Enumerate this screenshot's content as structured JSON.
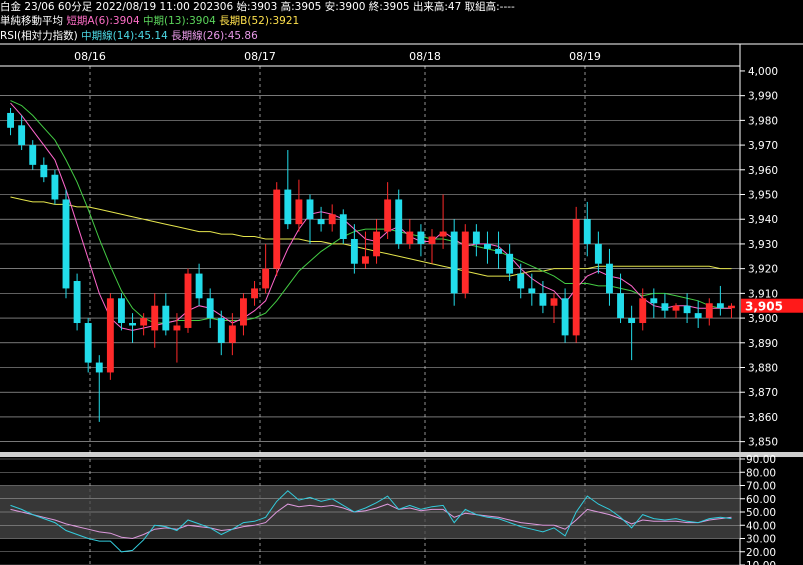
{
  "header": {
    "row1": "白金 23/06 60分足 2022/08/19 11:00 202306 始:3903 高:3905 安:3900 終:3905 出来高:47 取組高:----",
    "row2": {
      "title": "単純移動平均",
      "ma_short": "短期A(6):3904",
      "ma_mid": "中期(13):3904",
      "ma_long": "長期B(52):3921"
    },
    "row3": {
      "title": "RSI(相対力指数)",
      "rsi_mid": "中期線(14):45.14",
      "rsi_long": "長期線(26):45.86"
    }
  },
  "colors": {
    "up": "#ff2a2a",
    "down": "#22dcea",
    "ma_short": "#ff66cc",
    "ma_mid": "#44cc44",
    "ma_long": "#e6e64d",
    "rsi_mid": "#33ccdd",
    "rsi_long": "#dd99dd",
    "price_tag": "#ff1a1a",
    "grid": "#ffffff"
  },
  "chart_data": [
    {
      "type": "candlestick",
      "x_tick_labels": [
        "08/16",
        "08/17",
        "08/18",
        "08/19"
      ],
      "y_tick_labels": [
        "4,000",
        "3,990",
        "3,980",
        "3,970",
        "3,960",
        "3,950",
        "3,940",
        "3,930",
        "3,920",
        "3,910",
        "3,900",
        "3,890",
        "3,880",
        "3,870",
        "3,860",
        "3,850"
      ],
      "ylim": [
        3845,
        4002
      ],
      "last_price_label": "3,905",
      "last_price": 3905,
      "day_starts": [
        6,
        21,
        36
      ],
      "day_label_at": [
        4,
        19,
        34,
        49
      ],
      "ohlc": [
        [
          3983,
          3985,
          3974,
          3977
        ],
        [
          3978,
          3982,
          3968,
          3970
        ],
        [
          3970,
          3972,
          3960,
          3962
        ],
        [
          3962,
          3965,
          3955,
          3957
        ],
        [
          3958,
          3960,
          3946,
          3948
        ],
        [
          3948,
          3952,
          3908,
          3912
        ],
        [
          3915,
          3918,
          3895,
          3898
        ],
        [
          3898,
          3900,
          3878,
          3882
        ],
        [
          3882,
          3885,
          3858,
          3878
        ],
        [
          3878,
          3910,
          3875,
          3908
        ],
        [
          3908,
          3910,
          3895,
          3898
        ],
        [
          3898,
          3902,
          3890,
          3897
        ],
        [
          3897,
          3902,
          3893,
          3900
        ],
        [
          3895,
          3910,
          3888,
          3905
        ],
        [
          3905,
          3910,
          3893,
          3895
        ],
        [
          3895,
          3902,
          3882,
          3897
        ],
        [
          3896,
          3920,
          3894,
          3918
        ],
        [
          3918,
          3922,
          3905,
          3908
        ],
        [
          3908,
          3912,
          3896,
          3900
        ],
        [
          3900,
          3903,
          3885,
          3890
        ],
        [
          3890,
          3902,
          3885,
          3897
        ],
        [
          3897,
          3910,
          3893,
          3908
        ],
        [
          3908,
          3915,
          3905,
          3912
        ],
        [
          3912,
          3930,
          3910,
          3920
        ],
        [
          3920,
          3955,
          3917,
          3952
        ],
        [
          3952,
          3968,
          3936,
          3938
        ],
        [
          3938,
          3956,
          3935,
          3948
        ],
        [
          3948,
          3950,
          3930,
          3940
        ],
        [
          3940,
          3945,
          3935,
          3938
        ],
        [
          3938,
          3946,
          3935,
          3942
        ],
        [
          3942,
          3944,
          3930,
          3932
        ],
        [
          3932,
          3938,
          3918,
          3922
        ],
        [
          3922,
          3935,
          3920,
          3925
        ],
        [
          3925,
          3940,
          3922,
          3935
        ],
        [
          3935,
          3955,
          3932,
          3948
        ],
        [
          3948,
          3952,
          3928,
          3930
        ],
        [
          3930,
          3940,
          3928,
          3935
        ],
        [
          3935,
          3938,
          3925,
          3930
        ],
        [
          3930,
          3936,
          3922,
          3933
        ],
        [
          3933,
          3950,
          3928,
          3935
        ],
        [
          3935,
          3940,
          3905,
          3910
        ],
        [
          3910,
          3938,
          3908,
          3935
        ],
        [
          3935,
          3938,
          3925,
          3930
        ],
        [
          3930,
          3935,
          3922,
          3928
        ],
        [
          3928,
          3935,
          3920,
          3926
        ],
        [
          3926,
          3930,
          3915,
          3918
        ],
        [
          3918,
          3922,
          3908,
          3912
        ],
        [
          3912,
          3918,
          3905,
          3910
        ],
        [
          3910,
          3915,
          3902,
          3905
        ],
        [
          3905,
          3910,
          3898,
          3908
        ],
        [
          3908,
          3912,
          3890,
          3893
        ],
        [
          3893,
          3945,
          3890,
          3940
        ],
        [
          3940,
          3947,
          3925,
          3930
        ],
        [
          3930,
          3935,
          3918,
          3922
        ],
        [
          3922,
          3928,
          3905,
          3910
        ],
        [
          3910,
          3918,
          3898,
          3900
        ],
        [
          3900,
          3905,
          3883,
          3898
        ],
        [
          3898,
          3912,
          3895,
          3908
        ],
        [
          3908,
          3912,
          3900,
          3906
        ],
        [
          3906,
          3910,
          3900,
          3903
        ],
        [
          3903,
          3906,
          3900,
          3905
        ],
        [
          3905,
          3910,
          3898,
          3902
        ],
        [
          3902,
          3907,
          3896,
          3900
        ],
        [
          3900,
          3908,
          3897,
          3906
        ],
        [
          3906,
          3913,
          3901,
          3904
        ],
        [
          3904,
          3906,
          3900,
          3905
        ]
      ],
      "ma_short": [
        3987,
        3982,
        3976,
        3970,
        3964,
        3952,
        3938,
        3924,
        3910,
        3900,
        3896,
        3895,
        3896,
        3897,
        3898,
        3899,
        3903,
        3905,
        3904,
        3901,
        3898,
        3900,
        3903,
        3907,
        3918,
        3928,
        3936,
        3942,
        3943,
        3942,
        3940,
        3936,
        3932,
        3931,
        3935,
        3937,
        3933,
        3931,
        3931,
        3935,
        3932,
        3929,
        3930,
        3930,
        3929,
        3925,
        3920,
        3916,
        3913,
        3911,
        3906,
        3912,
        3917,
        3919,
        3917,
        3916,
        3913,
        3908,
        3905,
        3904,
        3905,
        3905,
        3904,
        3904,
        3904,
        3904
      ],
      "ma_mid": [
        3988,
        3986,
        3982,
        3977,
        3972,
        3964,
        3955,
        3944,
        3932,
        3921,
        3911,
        3904,
        3900,
        3898,
        3898,
        3899,
        3899,
        3899,
        3900,
        3899,
        3899,
        3899,
        3900,
        3902,
        3907,
        3913,
        3919,
        3923,
        3927,
        3930,
        3933,
        3935,
        3936,
        3936,
        3936,
        3935,
        3934,
        3933,
        3932,
        3932,
        3931,
        3930,
        3929,
        3928,
        3927,
        3925,
        3923,
        3921,
        3919,
        3917,
        3914,
        3914,
        3914,
        3913,
        3913,
        3912,
        3911,
        3909,
        3910,
        3910,
        3909,
        3908,
        3907,
        3905,
        3904,
        3904
      ],
      "ma_long": [
        3949,
        3948,
        3947,
        3947,
        3946,
        3946,
        3945,
        3945,
        3944,
        3943,
        3942,
        3941,
        3940,
        3939,
        3938,
        3937,
        3936,
        3935,
        3935,
        3934,
        3934,
        3933,
        3933,
        3932,
        3932,
        3932,
        3932,
        3931,
        3931,
        3930,
        3930,
        3929,
        3928,
        3927,
        3926,
        3925,
        3924,
        3923,
        3922,
        3921,
        3920,
        3919,
        3918,
        3917,
        3917,
        3917,
        3918,
        3919,
        3919,
        3920,
        3920,
        3920,
        3920,
        3921,
        3921,
        3921,
        3921,
        3921,
        3921,
        3921,
        3921,
        3921,
        3921,
        3921,
        3920,
        3920
      ]
    },
    {
      "type": "line",
      "name": "RSI",
      "y_tick_labels": [
        "90.00",
        "80.00",
        "70.00",
        "60.00",
        "50.00",
        "40.00",
        "30.00",
        "20.00",
        "10.00"
      ],
      "ylim": [
        10,
        90
      ],
      "band": [
        30,
        70
      ],
      "series": [
        {
          "key": "rsi_mid",
          "values": [
            55,
            52,
            48,
            45,
            42,
            36,
            33,
            30,
            28,
            28,
            20,
            21,
            29,
            40,
            39,
            36,
            44,
            41,
            38,
            33,
            37,
            42,
            43,
            46,
            58,
            66,
            59,
            61,
            58,
            60,
            55,
            50,
            53,
            57,
            62,
            52,
            55,
            52,
            54,
            55,
            42,
            52,
            48,
            46,
            45,
            42,
            39,
            37,
            35,
            38,
            32,
            50,
            62,
            56,
            52,
            46,
            38,
            48,
            45,
            44,
            45,
            43,
            42,
            45,
            46,
            45
          ]
        },
        {
          "key": "rsi_long",
          "values": [
            52,
            50,
            48,
            46,
            44,
            41,
            39,
            37,
            35,
            34,
            31,
            30,
            33,
            37,
            38,
            37,
            40,
            39,
            38,
            36,
            37,
            39,
            40,
            42,
            50,
            56,
            54,
            55,
            54,
            55,
            53,
            50,
            51,
            53,
            56,
            52,
            53,
            51,
            52,
            52,
            46,
            49,
            48,
            47,
            46,
            44,
            42,
            41,
            40,
            40,
            37,
            44,
            52,
            50,
            48,
            45,
            41,
            44,
            43,
            43,
            43,
            42,
            42,
            44,
            45,
            46
          ]
        }
      ]
    }
  ]
}
